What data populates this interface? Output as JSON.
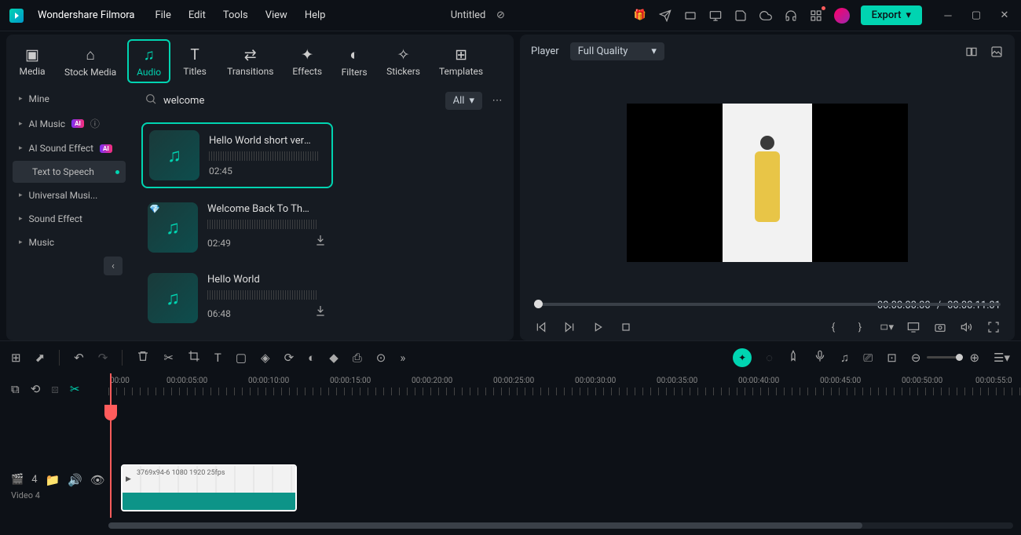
{
  "app": {
    "name": "Wondershare Filmora",
    "doc_title": "Untitled"
  },
  "menus": [
    "File",
    "Edit",
    "Tools",
    "View",
    "Help"
  ],
  "export_label": "Export",
  "media_tabs": [
    {
      "label": "Media"
    },
    {
      "label": "Stock Media"
    },
    {
      "label": "Audio"
    },
    {
      "label": "Titles"
    },
    {
      "label": "Transitions"
    },
    {
      "label": "Effects"
    },
    {
      "label": "Filters"
    },
    {
      "label": "Stickers"
    },
    {
      "label": "Templates"
    }
  ],
  "side": {
    "items": [
      {
        "label": "Mine"
      },
      {
        "label": "AI Music",
        "badge": "AI"
      },
      {
        "label": "AI Sound Effect",
        "badge": "AI"
      },
      {
        "label": "Text to Speech"
      },
      {
        "label": "Universal Musi..."
      },
      {
        "label": "Sound Effect"
      },
      {
        "label": "Music"
      }
    ]
  },
  "search": {
    "value": "welcome",
    "filter": "All"
  },
  "audio_items": [
    {
      "title": "Hello World short versi...",
      "time": "02:45",
      "active": true
    },
    {
      "title": "Welcome Back To The ...",
      "time": "02:49",
      "gem": true,
      "dl": true
    },
    {
      "title": "Hello World",
      "time": "06:48",
      "dl": true
    }
  ],
  "player": {
    "label": "Player",
    "quality": "Full Quality",
    "cur": "00:00:00:00",
    "sep": "/",
    "dur": "00:00:11:01"
  },
  "timeline": {
    "marks": [
      "00:00",
      "00:00:05:00",
      "00:00:10:00",
      "00:00:15:00",
      "00:00:20:00",
      "00:00:25:00",
      "00:00:30:00",
      "00:00:35:00",
      "00:00:40:00",
      "00:00:45:00",
      "00:00:50:00",
      "00:00:55:0"
    ],
    "track_num": "4",
    "track_name": "Video 4",
    "clip_label": "3769x94-6 1080 1920 25fps"
  }
}
